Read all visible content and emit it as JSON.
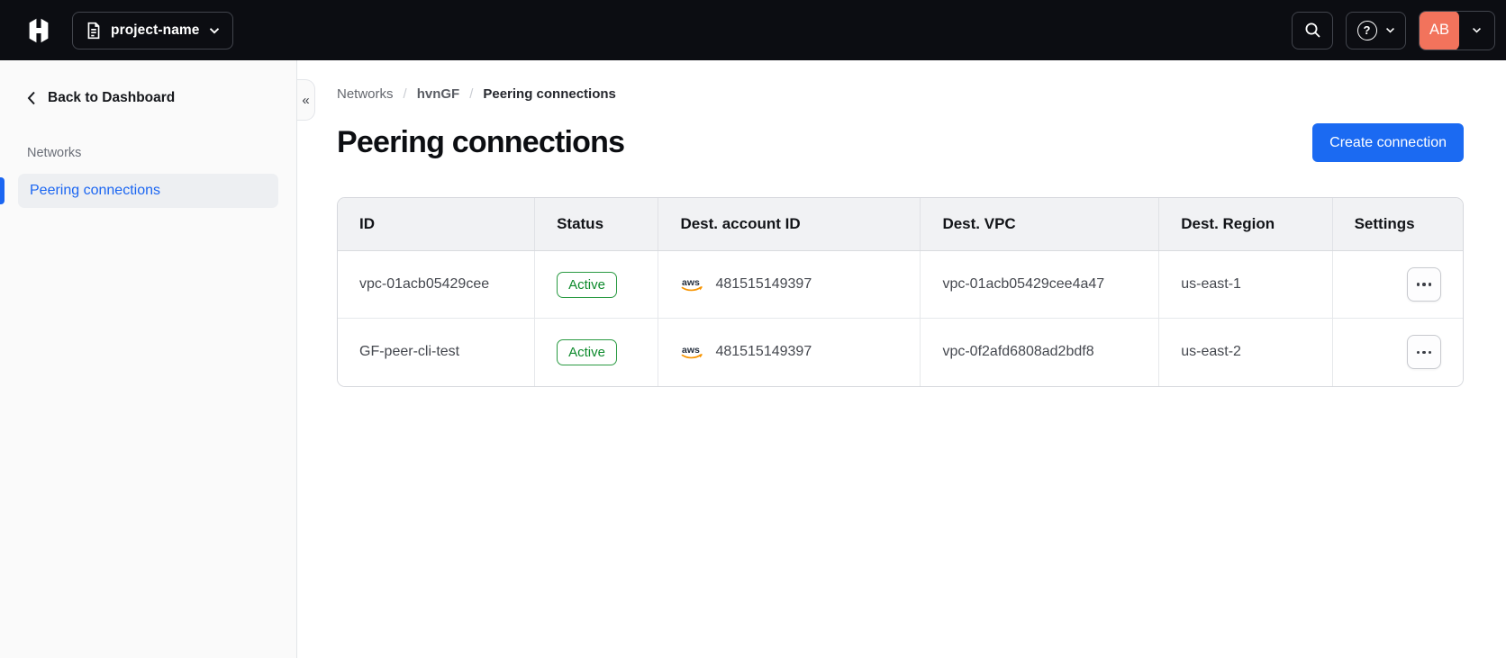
{
  "topbar": {
    "project_switcher": {
      "label": "project-name"
    },
    "user_menu": {
      "avatar_initials": "AB"
    }
  },
  "icons": {
    "help_glyph": "?",
    "collapse_glyph": "«",
    "aws_label": "aws"
  },
  "sidebar": {
    "back_link": "Back to Dashboard",
    "section_label": "Networks",
    "items": [
      {
        "label": "Peering connections",
        "active": true
      }
    ]
  },
  "breadcrumb": {
    "items": [
      "Networks",
      "hvnGF",
      "Peering connections"
    ],
    "separator": "/"
  },
  "page": {
    "title": "Peering connections",
    "create_button_label": "Create connection"
  },
  "table": {
    "columns": [
      "ID",
      "Status",
      "Dest. account ID",
      "Dest. VPC",
      "Dest. Region",
      "Settings"
    ],
    "rows": [
      {
        "id": "vpc-01acb05429cee",
        "status": "Active",
        "provider": "aws",
        "dest_account_id": "481515149397",
        "dest_vpc": "vpc-01acb05429cee4a47",
        "dest_region": "us-east-1"
      },
      {
        "id": "GF-peer-cli-test",
        "status": "Active",
        "provider": "aws",
        "dest_account_id": "481515149397",
        "dest_vpc": "vpc-0f2afd6808ad2bdf8",
        "dest_region": "us-east-2"
      }
    ]
  },
  "colors": {
    "topbar_bg": "#0c0d12",
    "accent_blue": "#1b66f2",
    "button_blue": "#1b6af2",
    "success_green": "#0d8a2c",
    "avatar_salmon": "#f2735c",
    "sidebar_bg": "#fafafa"
  }
}
